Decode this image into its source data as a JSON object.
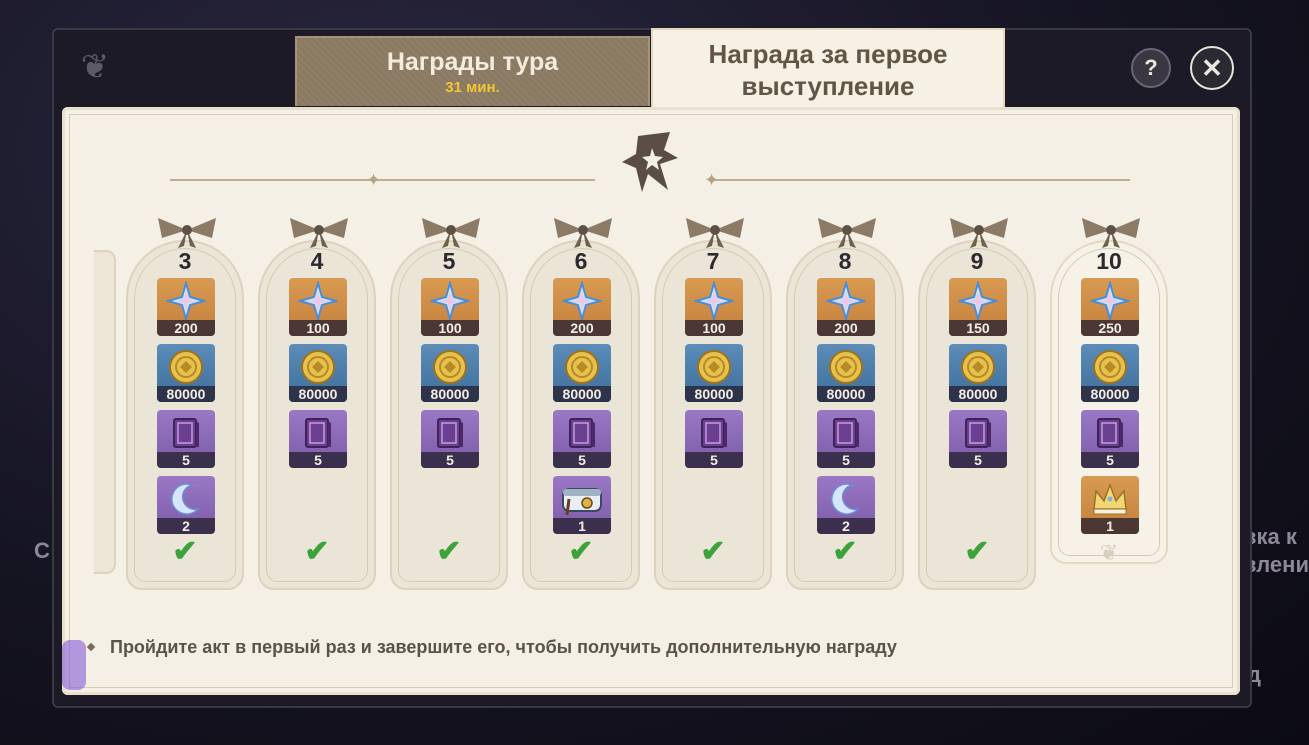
{
  "tabs": {
    "rounds": {
      "title": "Награды тура",
      "timer": "31 мин."
    },
    "first": {
      "title_line1": "Награда за первое",
      "title_line2": "выступление"
    }
  },
  "buttons": {
    "help": "?",
    "close": "✕"
  },
  "footer_hint": "Пройдите акт в первый раз и завершите его, чтобы получить дополнительную награду",
  "backdrop": {
    "left_partial": "С",
    "right_partial_1": "вка к",
    "right_partial_2": "влени",
    "right_partial_3": "д"
  },
  "colors": {
    "claimed_check": "#3ca33a",
    "timer": "#f4c534",
    "panel": "#f4f0e6"
  },
  "columns": [
    {
      "number": "3",
      "claimed": true,
      "items": [
        {
          "icon": "primogem-icon",
          "qty": "200",
          "bg": "gold"
        },
        {
          "icon": "mora-coin-icon",
          "qty": "80000",
          "bg": "blue"
        },
        {
          "icon": "purple-book-icon",
          "qty": "5",
          "bg": "purple"
        },
        {
          "icon": "crescent-moon-icon",
          "qty": "2",
          "bg": "purple"
        }
      ]
    },
    {
      "number": "4",
      "claimed": true,
      "items": [
        {
          "icon": "primogem-icon",
          "qty": "100",
          "bg": "gold"
        },
        {
          "icon": "mora-coin-icon",
          "qty": "80000",
          "bg": "blue"
        },
        {
          "icon": "purple-book-icon",
          "qty": "5",
          "bg": "purple"
        }
      ]
    },
    {
      "number": "5",
      "claimed": true,
      "items": [
        {
          "icon": "primogem-icon",
          "qty": "100",
          "bg": "gold"
        },
        {
          "icon": "mora-coin-icon",
          "qty": "80000",
          "bg": "blue"
        },
        {
          "icon": "purple-book-icon",
          "qty": "5",
          "bg": "purple"
        }
      ]
    },
    {
      "number": "6",
      "claimed": true,
      "items": [
        {
          "icon": "primogem-icon",
          "qty": "200",
          "bg": "gold"
        },
        {
          "icon": "mora-coin-icon",
          "qty": "80000",
          "bg": "blue"
        },
        {
          "icon": "purple-book-icon",
          "qty": "5",
          "bg": "purple"
        },
        {
          "icon": "gadget-box-icon",
          "qty": "1",
          "bg": "purple"
        }
      ]
    },
    {
      "number": "7",
      "claimed": true,
      "items": [
        {
          "icon": "primogem-icon",
          "qty": "100",
          "bg": "gold"
        },
        {
          "icon": "mora-coin-icon",
          "qty": "80000",
          "bg": "blue"
        },
        {
          "icon": "purple-book-icon",
          "qty": "5",
          "bg": "purple"
        }
      ]
    },
    {
      "number": "8",
      "claimed": true,
      "items": [
        {
          "icon": "primogem-icon",
          "qty": "200",
          "bg": "gold"
        },
        {
          "icon": "mora-coin-icon",
          "qty": "80000",
          "bg": "blue"
        },
        {
          "icon": "purple-book-icon",
          "qty": "5",
          "bg": "purple"
        },
        {
          "icon": "crescent-moon-icon",
          "qty": "2",
          "bg": "purple"
        }
      ]
    },
    {
      "number": "9",
      "claimed": true,
      "items": [
        {
          "icon": "primogem-icon",
          "qty": "150",
          "bg": "gold"
        },
        {
          "icon": "mora-coin-icon",
          "qty": "80000",
          "bg": "blue"
        },
        {
          "icon": "purple-book-icon",
          "qty": "5",
          "bg": "purple"
        }
      ]
    },
    {
      "number": "10",
      "claimed": false,
      "items": [
        {
          "icon": "primogem-icon",
          "qty": "250",
          "bg": "gold"
        },
        {
          "icon": "mora-coin-icon",
          "qty": "80000",
          "bg": "blue"
        },
        {
          "icon": "purple-book-icon",
          "qty": "5",
          "bg": "purple"
        },
        {
          "icon": "crown-icon",
          "qty": "1",
          "bg": "gold"
        }
      ]
    }
  ]
}
